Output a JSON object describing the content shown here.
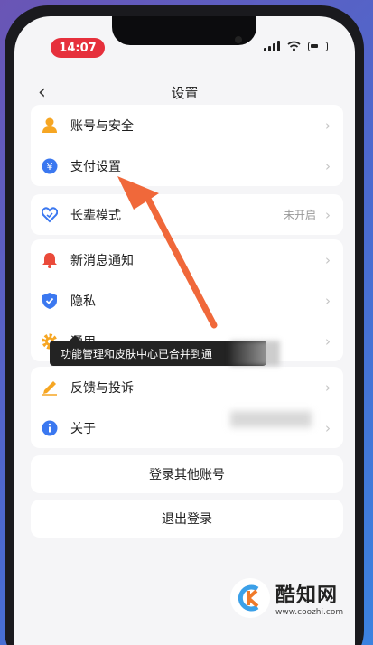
{
  "status_bar": {
    "time": "14:07"
  },
  "nav": {
    "back_glyph": "‹",
    "title": "设置"
  },
  "groups": [
    {
      "items": [
        {
          "label": "账号与安全",
          "icon": "user-icon",
          "value": ""
        },
        {
          "label": "支付设置",
          "icon": "payment-icon",
          "value": ""
        }
      ]
    },
    {
      "items": [
        {
          "label": "长辈模式",
          "icon": "heart-shield-icon",
          "value": "未开启"
        }
      ]
    },
    {
      "items": [
        {
          "label": "新消息通知",
          "icon": "bell-icon",
          "value": ""
        },
        {
          "label": "隐私",
          "icon": "privacy-shield-icon",
          "value": ""
        },
        {
          "label": "通用",
          "icon": "gear-icon",
          "value": ""
        }
      ]
    },
    {
      "items": [
        {
          "label": "反馈与投诉",
          "icon": "pencil-icon",
          "value": ""
        },
        {
          "label": "关于",
          "icon": "info-icon",
          "value": ""
        }
      ]
    }
  ],
  "tooltip": "功能管理和皮肤中心已合并到通",
  "buttons": {
    "switch_account": "登录其他账号",
    "logout": "退出登录"
  },
  "watermark": {
    "name": "酷知网",
    "url": "www.coozhi.com"
  },
  "colors": {
    "accent_red": "#e6303c",
    "arrow": "#f0683a",
    "blue": "#3b78f0",
    "orange": "#f6a623"
  }
}
